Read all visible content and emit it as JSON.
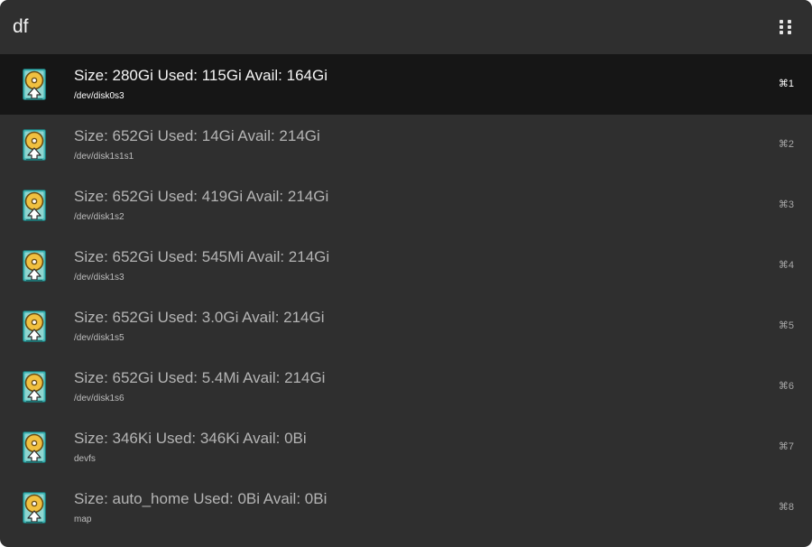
{
  "search": {
    "query": "df",
    "menu_icon": "grip-dots-icon"
  },
  "colors": {
    "window_bg": "#2f2f2f",
    "selected_row_bg": "#161616",
    "disk_icon_teal": "#3db3b3",
    "disk_icon_yellow": "#f0c040"
  },
  "results": {
    "items": [
      {
        "title": "Size: 280Gi Used: 115Gi Avail: 164Gi",
        "subtitle": "/dev/disk0s3",
        "shortcut": "⌘1",
        "icon": "hard-disk-icon",
        "selected": true
      },
      {
        "title": "Size: 652Gi Used: 14Gi Avail: 214Gi",
        "subtitle": "/dev/disk1s1s1",
        "shortcut": "⌘2",
        "icon": "hard-disk-icon",
        "selected": false
      },
      {
        "title": "Size: 652Gi Used: 419Gi Avail: 214Gi",
        "subtitle": "/dev/disk1s2",
        "shortcut": "⌘3",
        "icon": "hard-disk-icon",
        "selected": false
      },
      {
        "title": "Size: 652Gi Used: 545Mi Avail: 214Gi",
        "subtitle": "/dev/disk1s3",
        "shortcut": "⌘4",
        "icon": "hard-disk-icon",
        "selected": false
      },
      {
        "title": "Size: 652Gi Used: 3.0Gi Avail: 214Gi",
        "subtitle": "/dev/disk1s5",
        "shortcut": "⌘5",
        "icon": "hard-disk-icon",
        "selected": false
      },
      {
        "title": "Size: 652Gi Used: 5.4Mi Avail: 214Gi",
        "subtitle": "/dev/disk1s6",
        "shortcut": "⌘6",
        "icon": "hard-disk-icon",
        "selected": false
      },
      {
        "title": "Size: 346Ki Used: 346Ki Avail: 0Bi",
        "subtitle": "devfs",
        "shortcut": "⌘7",
        "icon": "hard-disk-icon",
        "selected": false
      },
      {
        "title": "Size: auto_home Used: 0Bi Avail: 0Bi",
        "subtitle": "map",
        "shortcut": "⌘8",
        "icon": "hard-disk-icon",
        "selected": false
      }
    ]
  }
}
